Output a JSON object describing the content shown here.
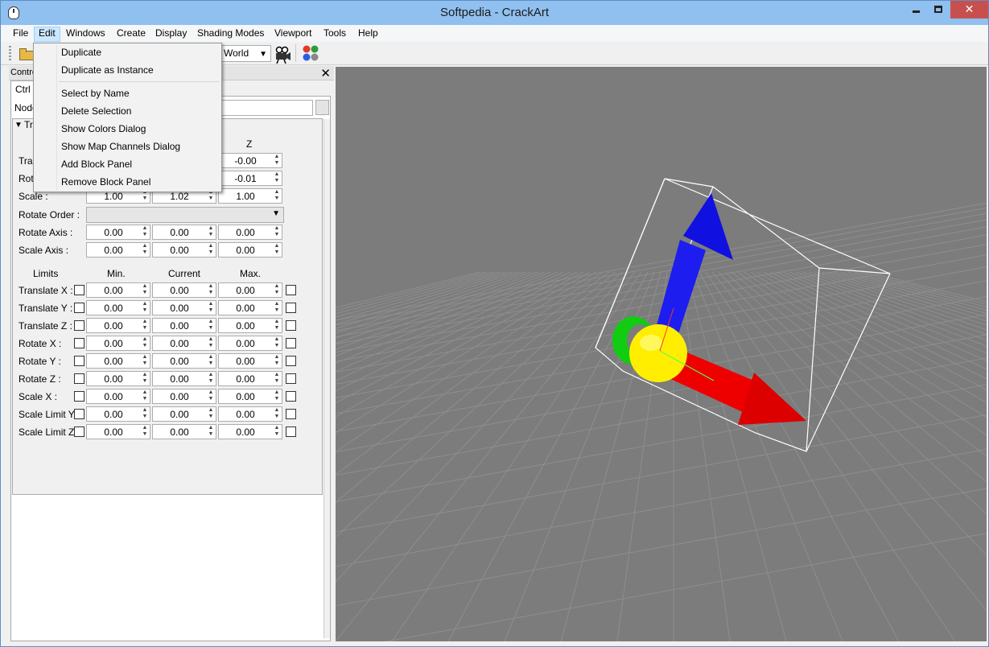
{
  "window": {
    "title": "Softpedia - CrackArt"
  },
  "menubar": {
    "items": [
      "File",
      "Edit",
      "Windows",
      "Create",
      "Display",
      "Shading Modes",
      "Viewport",
      "Tools",
      "Help"
    ]
  },
  "toolbar": {
    "space_value": "World"
  },
  "edit_menu": {
    "group1": [
      "Duplicate",
      "Duplicate as Instance"
    ],
    "group2": [
      "Select by Name",
      "Delete Selection",
      "Show Colors Dialog",
      "Show Map Channels Dialog",
      "Add Block Panel",
      "Remove Block Panel"
    ]
  },
  "panel": {
    "title": "Contro",
    "tab": "Ctrl",
    "node_label": "Node",
    "group_title": "Tr",
    "col_z": "Z",
    "rows": [
      {
        "label": "Tran",
        "z": "-0.00"
      },
      {
        "label": "Rot",
        "z": "-0.01"
      },
      {
        "label": "Scale :",
        "x": "1.00",
        "y": "1.02",
        "z": "1.00"
      }
    ],
    "rotate_order_label": "Rotate Order :",
    "rotate_axis": {
      "label": "Rotate Axis :",
      "x": "0.00",
      "y": "0.00",
      "z": "0.00"
    },
    "scale_axis": {
      "label": "Scale Axis :",
      "x": "0.00",
      "y": "0.00",
      "z": "0.00"
    },
    "limits": {
      "header": "Limits",
      "min": "Min.",
      "current": "Current",
      "max": "Max.",
      "rows": [
        {
          "label": "Translate X :",
          "min": "0.00",
          "current": "0.00",
          "max": "0.00"
        },
        {
          "label": "Translate Y :",
          "min": "0.00",
          "current": "0.00",
          "max": "0.00"
        },
        {
          "label": "Translate Z :",
          "min": "0.00",
          "current": "0.00",
          "max": "0.00"
        },
        {
          "label": "Rotate X :",
          "min": "0.00",
          "current": "0.00",
          "max": "0.00"
        },
        {
          "label": "Rotate Y :",
          "min": "0.00",
          "current": "0.00",
          "max": "0.00"
        },
        {
          "label": "Rotate Z :",
          "min": "0.00",
          "current": "0.00",
          "max": "0.00"
        },
        {
          "label": "Scale X :",
          "min": "0.00",
          "current": "0.00",
          "max": "0.00"
        },
        {
          "label": "Scale Limit Y :",
          "min": "0.00",
          "current": "0.00",
          "max": "0.00"
        },
        {
          "label": "Scale Limit Z :",
          "min": "0.00",
          "current": "0.00",
          "max": "0.00"
        }
      ]
    }
  },
  "colors": {
    "titlebar": "#8fc0ef",
    "viewport_bg": "#7c7c7c",
    "close_button": "#c7504f",
    "axis_x": "#ff0000",
    "axis_y": "#00dd00",
    "axis_z": "#0000ff",
    "center_sphere": "#ffff00"
  }
}
